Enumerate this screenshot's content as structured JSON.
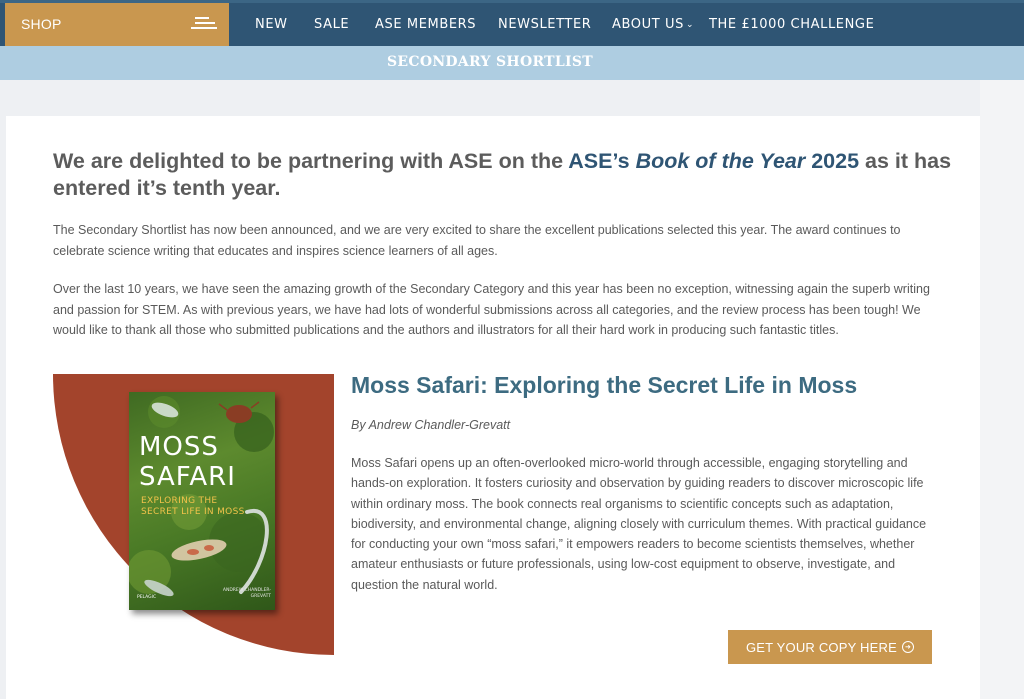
{
  "nav": {
    "shop_label": "SHOP",
    "menu_icon": "hamburger-icon",
    "links": [
      "NEW",
      "SALE",
      "ASE MEMBERS",
      "NEWSLETTER",
      "ABOUT US",
      "THE £1000 CHALLENGE"
    ],
    "dropdown_icon": "chevron-down-icon"
  },
  "banner": {
    "title": "SECONDARY SHORTLIST"
  },
  "intro": {
    "heading_part1": "We are delighted to be partnering with ASE on the ",
    "heading_ase": "ASE’s ",
    "heading_book": "Book of the Year",
    "heading_year": " 2025",
    "heading_part2": " as it has entered it’s tenth year.",
    "paragraph1": "The Secondary Shortlist has now been announced, and we are very excited to share the excellent publications selected this year. The award continues to celebrate science writing that educates and inspires science learners of all ages.",
    "paragraph2": "Over the last 10 years, we have seen the amazing growth of the Secondary Category and this year has been no exception, witnessing again the superb writing and passion for STEM. As with previous years, we have had lots of wonderful submissions across all categories, and the review process has been tough! We would like to thank all those who submitted publications and the authors and illustrators for all their hard work in producing such fantastic titles."
  },
  "book": {
    "title": "Moss Safari: Exploring the Secret Life in Moss",
    "author": "By Andrew Chandler-Grevatt",
    "description": "Moss Safari opens up an often-overlooked micro-world through accessible, engaging storytelling and hands-on exploration. It fosters curiosity and observation by guiding readers to discover microscopic life within ordinary moss. The book connects real organisms to scientific concepts such as adaptation, biodiversity, and environmental change, aligning closely with curriculum themes. With practical guidance for conducting your own “moss safari,” it empowers readers to become scientists themselves, whether amateur enthusiasts or future professionals, using low-cost equipment to observe, investigate, and question the natural world.",
    "cover": {
      "title_line1": "MOSS",
      "title_line2": "SAFARI",
      "subtitle": "EXPLORING THE SECRET LIFE IN MOSS",
      "author": "ANDREW CHANDLER-GREVATT",
      "publisher": "PELAGIC"
    },
    "cta_label": "GET YOUR COPY HERE",
    "cta_icon": "arrow-circle-right-icon"
  },
  "colors": {
    "nav_bg": "#2f5574",
    "accent_gold": "#c9974f",
    "banner_bg": "#aecde1",
    "feature_red": "#a3442c",
    "title_teal": "#3d6b81"
  }
}
